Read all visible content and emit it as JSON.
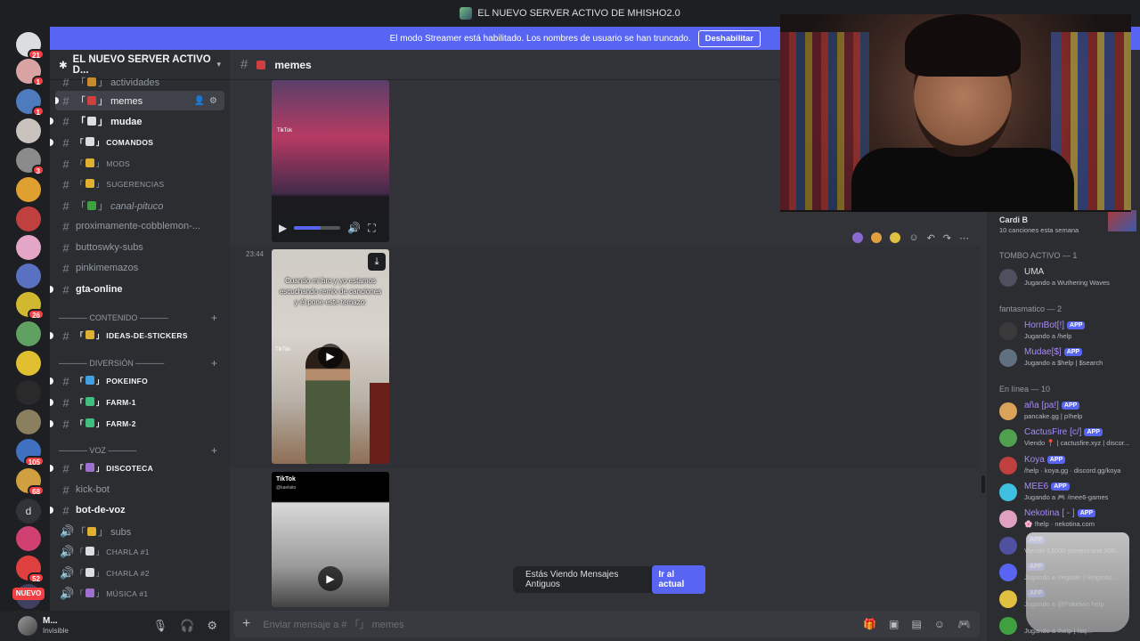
{
  "window": {
    "title": "EL NUEVO SERVER ACTIVO DE MHISHO2.0"
  },
  "banner": {
    "text": "El modo Streamer está habilitado. Los nombres de usuario se han truncado.",
    "button": "Deshabilitar"
  },
  "servers": [
    {
      "badge": "21",
      "color": "#dbdee1"
    },
    {
      "badge": "1",
      "color": "#d9a3a3"
    },
    {
      "badge": "1",
      "color": "#4d7bbd"
    },
    {
      "badge": "",
      "color": "#c9c2bd"
    },
    {
      "badge": "3",
      "color": "#8b8b8b"
    },
    {
      "badge": "",
      "color": "#e0a030"
    },
    {
      "badge": "",
      "color": "#c04040"
    },
    {
      "badge": "",
      "color": "#e4a6c7"
    },
    {
      "badge": "",
      "color": "#5a70c0"
    },
    {
      "badge": "26",
      "color": "#d0b830"
    },
    {
      "badge": "",
      "color": "#60a060"
    },
    {
      "badge": "",
      "color": "#e0c030"
    },
    {
      "badge": "",
      "color": "#2a2a2a"
    },
    {
      "badge": "",
      "color": "#8a8060"
    },
    {
      "badge": "105",
      "color": "#4070c0"
    },
    {
      "badge": "68",
      "color": "#d0a040"
    },
    {
      "badge": "",
      "color": "#313338",
      "letter": "d"
    },
    {
      "badge": "",
      "color": "#d04070"
    },
    {
      "badge": "52",
      "color": "#e04040"
    },
    {
      "badge": "",
      "color": "#404060"
    }
  ],
  "nuevo_label": "NUEVO",
  "server_header": {
    "name": "EL NUEVO SERVER ACTIVO D..."
  },
  "channels": [
    {
      "type": "text",
      "label": "actividades",
      "emoji": "#c98b2a",
      "unread": false,
      "small": false,
      "partial": true
    },
    {
      "type": "text",
      "label": "memes",
      "emoji": "#d04040",
      "active": true
    },
    {
      "type": "text",
      "label": "mudae",
      "emoji": "#dbdee1",
      "unread": true
    },
    {
      "type": "text",
      "label": "COMANDOS",
      "emoji": "#dbdee1",
      "unread": true,
      "small": true
    },
    {
      "type": "text",
      "label": "MODS",
      "emoji": "#e0b030",
      "small": true
    },
    {
      "type": "text",
      "label": "SUGERENCIAS",
      "emoji": "#e0b030",
      "small": true
    },
    {
      "type": "text",
      "label": "canal-pituco",
      "emoji": "#40a040",
      "italic": true
    },
    {
      "type": "text",
      "label": "proximamente-cobblemon-..."
    },
    {
      "type": "text",
      "label": "buttoswky-subs"
    },
    {
      "type": "text",
      "label": "pinkimemazos"
    },
    {
      "type": "text",
      "label": "gta-online",
      "unread": true
    }
  ],
  "category_contenido": "───── CONTENIDO ─────",
  "channels_contenido": [
    {
      "label": "IDEAS-DE-STICKERS",
      "emoji": "#e0b030",
      "unread": true,
      "small": true
    }
  ],
  "category_diversion": "───── DIVERSIÓN ─────",
  "channels_diversion": [
    {
      "label": "POKEINFO",
      "emoji": "#40a0e0",
      "unread": true,
      "small": true
    },
    {
      "label": "FARM-1",
      "emoji": "#40c080",
      "unread": true,
      "small": true
    },
    {
      "label": "FARM-2",
      "emoji": "#40c080",
      "unread": true,
      "small": true
    }
  ],
  "category_voz": "───── VOZ ─────",
  "channels_voz": [
    {
      "kind": "#",
      "label": "DISCOTECA",
      "emoji": "#a070d0",
      "unread": true,
      "small": true
    },
    {
      "kind": "#",
      "label": "kick-bot"
    },
    {
      "kind": "#",
      "label": "bot-de-voz",
      "unread": true
    },
    {
      "kind": "🔊",
      "label": "subs",
      "emoji": "#e0b030"
    },
    {
      "kind": "🔊",
      "label": "CHARLA #1",
      "emoji": "#dbdee1",
      "small": true
    },
    {
      "kind": "🔊",
      "label": "CHARLA #2",
      "emoji": "#dbdee1",
      "small": true
    },
    {
      "kind": "🔊",
      "label": "MÚSICA #1",
      "emoji": "#a070d0",
      "small": true
    }
  ],
  "user": {
    "name": "M...",
    "status": "Invisible"
  },
  "chat": {
    "channel": "memes",
    "timestamp": "23:44",
    "video2_caption": "Cuando mi bro y yo estamos escuchando remix de canciones y él pone este temazo:",
    "tiktok_label": "TikTok",
    "tiktok_handle": "@kaelaito",
    "old_messages": "Estás Viendo Mensajes Antiguos",
    "jump_button": "Ir al actual",
    "composer_placeholder": "Enviar mensaje a # 「」 memes"
  },
  "members": {
    "now_playing": {
      "name": "Cardi B",
      "sub": "10 canciones esta semana"
    },
    "group1": "TOMBO ACTIVO — 1",
    "group1_members": [
      {
        "name": "UMA",
        "status": "Jugando a Wuthering Waves",
        "color": "#dbdee1",
        "avatar": "#505060"
      }
    ],
    "group2": "fantasmatico — 2",
    "group2_members": [
      {
        "name": "HornBot[!]",
        "tag": "APP",
        "status": "Jugando a /help",
        "color": "#a78bfa",
        "avatar": "#3a3a3a"
      },
      {
        "name": "Mudae[$]",
        "tag": "APP",
        "status": "Jugando a $help | $search",
        "color": "#a78bfa",
        "avatar": "#607080"
      }
    ],
    "group3": "En línea — 10",
    "group3_members": [
      {
        "name": "aña [pa!]",
        "tag": "APP",
        "status": "pancake.gg | p!help",
        "color": "#a78bfa",
        "avatar": "#d9a35a"
      },
      {
        "name": "CactusFire [c/]",
        "tag": "APP",
        "status": "Viendo 📍 | cactusfire.xyz | discor...",
        "color": "#a78bfa",
        "avatar": "#50a050"
      },
      {
        "name": "Koya",
        "tag": "APP",
        "status": "/help · koya.gg · discord.gg/koya",
        "color": "#a78bfa",
        "avatar": "#c04040"
      },
      {
        "name": "MEE6",
        "tag": "APP",
        "status": "Jugando a 🎮 /mee6-games",
        "color": "#a78bfa",
        "avatar": "#40c0e0"
      },
      {
        "name": "Nekotina [ - ]",
        "tag": "APP",
        "status": "🌸 !help · nekotina.com",
        "color": "#a78bfa",
        "avatar": "#e0a0c0"
      },
      {
        "name": "",
        "tag": "APP",
        "status": "Viendo 12000 servers and 300...",
        "color": "#a78bfa",
        "avatar": "#5050a0"
      },
      {
        "name": "",
        "tag": "APP",
        "status": "Jugando a !register | !enginez...",
        "color": "#a78bfa",
        "avatar": "#5865f2"
      },
      {
        "name": "",
        "tag": "APP",
        "status": "Jugando a @Pokétwo help",
        "color": "#a78bfa",
        "avatar": "#e0c040"
      },
      {
        "name": "",
        "tag": "",
        "status": "Jugando a !help | faq...",
        "color": "#a78bfa",
        "avatar": "#40a040"
      }
    ]
  }
}
